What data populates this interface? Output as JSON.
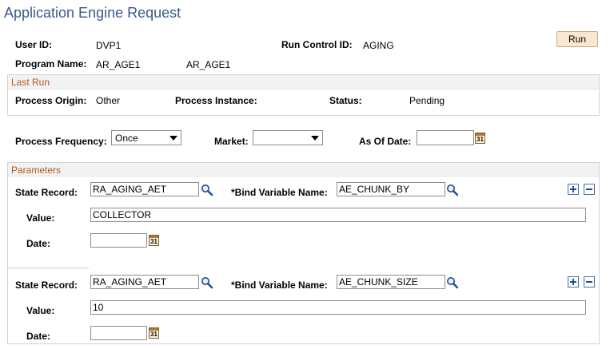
{
  "page": {
    "title": "Application Engine Request"
  },
  "header": {
    "user_id_label": "User ID:",
    "user_id_value": "DVP1",
    "run_control_label": "Run Control ID:",
    "run_control_value": "AGING",
    "program_name_label": "Program Name:",
    "program_name_value": "AR_AGE1",
    "program_desc_value": "AR_AGE1",
    "run_button": "Run"
  },
  "last_run": {
    "title": "Last Run",
    "process_origin_label": "Process Origin:",
    "process_origin_value": "Other",
    "process_instance_label": "Process Instance:",
    "process_instance_value": "",
    "status_label": "Status:",
    "status_value": "Pending"
  },
  "options": {
    "process_frequency_label": "Process Frequency:",
    "process_frequency_value": "Once",
    "market_label": "Market:",
    "market_value": "",
    "as_of_date_label": "As Of Date:",
    "as_of_date_value": ""
  },
  "parameters": {
    "title": "Parameters",
    "rows": [
      {
        "state_record_label": "State Record:",
        "state_record_value": "RA_AGING_AET",
        "bind_variable_label": "*Bind Variable Name:",
        "bind_variable_value": "AE_CHUNK_BY",
        "value_label": "Value:",
        "value_value": "COLLECTOR",
        "date_label": "Date:",
        "date_value": ""
      },
      {
        "state_record_label": "State Record:",
        "state_record_value": "RA_AGING_AET",
        "bind_variable_label": "*Bind Variable Name:",
        "bind_variable_value": "AE_CHUNK_SIZE",
        "value_label": "Value:",
        "value_value": "10",
        "date_label": "Date:",
        "date_value": ""
      }
    ]
  },
  "icons": {
    "lookup": "magnifier-icon",
    "calendar": "calendar-icon",
    "add": "plus-icon",
    "delete": "minus-icon"
  },
  "colors": {
    "title": "#3a5a8c",
    "group_title": "#b05a1c",
    "run_button_bg": "#fbe7cf",
    "icon_blue": "#1d4e9a"
  }
}
